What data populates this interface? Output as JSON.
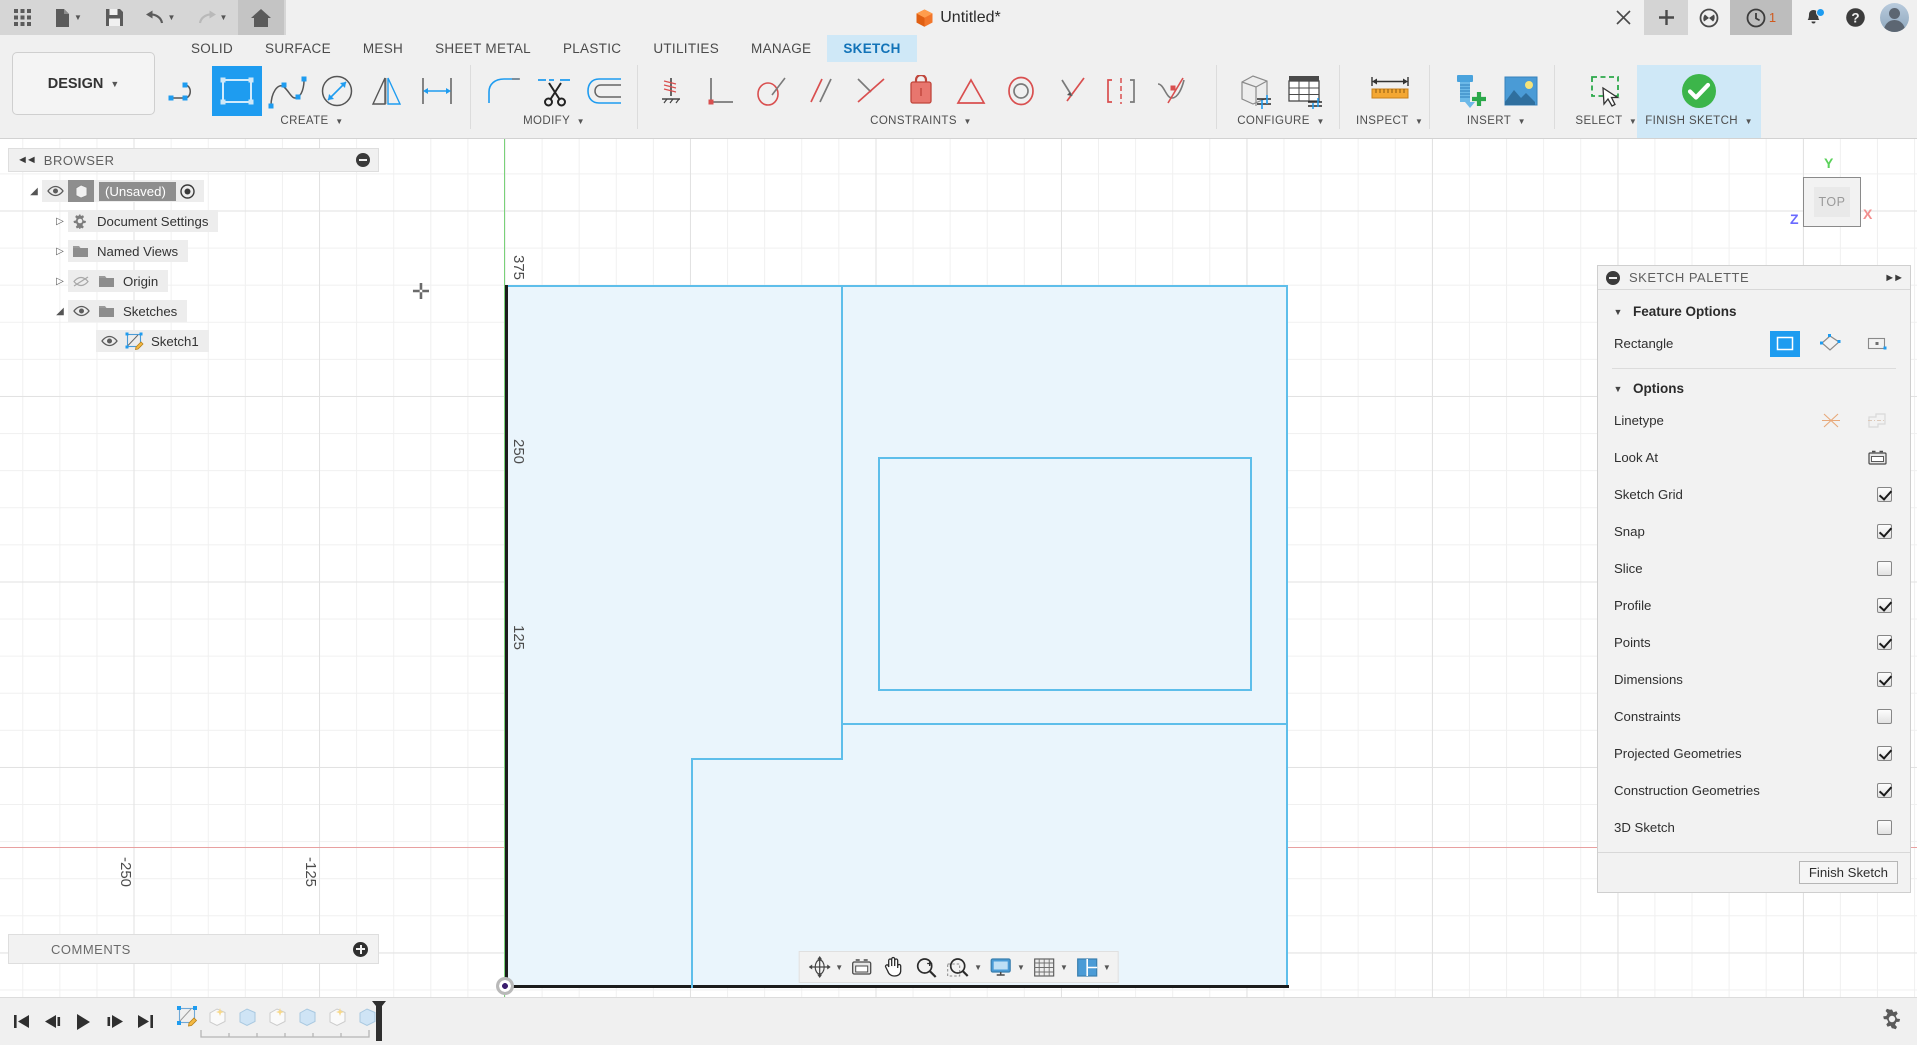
{
  "title_bar": {
    "document_title": "Untitled*",
    "quick_access": [
      {
        "name": "app-grid-icon",
        "label": "Apps"
      },
      {
        "name": "new-file-icon",
        "label": "File"
      },
      {
        "name": "save-icon",
        "label": "Save"
      },
      {
        "name": "undo-icon",
        "label": "Undo"
      },
      {
        "name": "redo-icon",
        "label": "Redo"
      },
      {
        "name": "home-icon",
        "label": "Home"
      }
    ],
    "right_actions": [
      {
        "name": "close-tab-icon",
        "label": "Close"
      },
      {
        "name": "add-tab-icon",
        "label": "New Tab"
      },
      {
        "name": "extensions-icon",
        "label": "Extensions"
      },
      {
        "name": "job-status-icon",
        "label": "Job Status",
        "badge": "1"
      },
      {
        "name": "notifications-icon",
        "label": "Notifications"
      },
      {
        "name": "help-icon",
        "label": "Help"
      },
      {
        "name": "account-avatar",
        "label": "Account"
      }
    ]
  },
  "ribbon": {
    "workspace": "DESIGN",
    "tabs": [
      {
        "label": "SOLID",
        "active": false
      },
      {
        "label": "SURFACE",
        "active": false
      },
      {
        "label": "MESH",
        "active": false
      },
      {
        "label": "SHEET METAL",
        "active": false
      },
      {
        "label": "PLASTIC",
        "active": false
      },
      {
        "label": "UTILITIES",
        "active": false
      },
      {
        "label": "MANAGE",
        "active": false
      },
      {
        "label": "SKETCH",
        "active": true
      }
    ],
    "groups": [
      {
        "name": "create",
        "label": "CREATE",
        "tools": [
          {
            "name": "line-tool",
            "label": "Line",
            "selected": false
          },
          {
            "name": "rectangle-tool",
            "label": "Rectangle",
            "selected": true
          },
          {
            "name": "spline-tool",
            "label": "Spline",
            "selected": false
          },
          {
            "name": "circle-tool",
            "label": "Circle",
            "selected": false
          },
          {
            "name": "mirror-tool",
            "label": "Mirror",
            "selected": false
          },
          {
            "name": "sketch-dimension-tool",
            "label": "Sketch Dimension",
            "selected": false
          }
        ]
      },
      {
        "name": "modify",
        "label": "MODIFY",
        "tools": [
          {
            "name": "fillet-tool",
            "label": "Fillet",
            "selected": false
          },
          {
            "name": "trim-tool",
            "label": "Trim",
            "selected": false
          },
          {
            "name": "offset-tool",
            "label": "Offset",
            "selected": false
          }
        ]
      },
      {
        "name": "constraints",
        "label": "CONSTRAINTS",
        "tools": [
          {
            "name": "fix-unfix-constraint",
            "label": "Fix/UnFix",
            "selected": false
          },
          {
            "name": "perpendicular-constraint",
            "label": "Perpendicular",
            "selected": false
          },
          {
            "name": "tangent-constraint",
            "label": "Tangent",
            "selected": false
          },
          {
            "name": "parallel-constraint",
            "label": "Parallel",
            "selected": false
          },
          {
            "name": "coincident-constraint",
            "label": "Coincident",
            "selected": false
          },
          {
            "name": "horizontal-vertical-constraint",
            "label": "Horizontal/Vertical",
            "selected": false
          },
          {
            "name": "equal-constraint",
            "label": "Equal",
            "selected": false
          },
          {
            "name": "concentric-constraint",
            "label": "Concentric",
            "selected": false
          },
          {
            "name": "collinear-constraint",
            "label": "Collinear",
            "selected": false
          },
          {
            "name": "symmetry-constraint",
            "label": "Symmetry",
            "selected": false
          },
          {
            "name": "curvature-constraint",
            "label": "Curvature",
            "selected": false
          }
        ]
      },
      {
        "name": "configure",
        "label": "CONFIGURE",
        "tools": [
          {
            "name": "configure-component-tool",
            "label": "Configure Component",
            "selected": false
          },
          {
            "name": "configure-table-tool",
            "label": "Configuration Table",
            "selected": false
          }
        ]
      },
      {
        "name": "inspect",
        "label": "INSPECT",
        "tools": [
          {
            "name": "measure-tool",
            "label": "Measure",
            "selected": false
          }
        ]
      },
      {
        "name": "insert",
        "label": "INSERT",
        "tools": [
          {
            "name": "insert-mcmaster-tool",
            "label": "Insert McMaster-Carr Component",
            "selected": false
          },
          {
            "name": "insert-canvas-tool",
            "label": "Canvas",
            "selected": false
          }
        ]
      },
      {
        "name": "select",
        "label": "SELECT",
        "tools": [
          {
            "name": "select-tool",
            "label": "Select",
            "selected": false
          }
        ]
      },
      {
        "name": "finish-sketch",
        "label": "FINISH SKETCH",
        "highlighted": true,
        "tools": [
          {
            "name": "finish-sketch-tool",
            "label": "Finish Sketch",
            "selected": false
          }
        ]
      }
    ]
  },
  "browser": {
    "title": "BROWSER",
    "collapse_icon": "minus-circle-icon",
    "expand_icon": "double-chevron-left-icon",
    "items": [
      {
        "name": "browser-item-unsaved",
        "label": "(Unsaved)",
        "indent": 0,
        "expanded": true,
        "visible": true,
        "selected": true,
        "icon": "component-icon",
        "has_activate_dot": true
      },
      {
        "name": "browser-item-document-settings",
        "label": "Document Settings",
        "indent": 1,
        "expanded": false,
        "visible": null,
        "icon": "gear-icon"
      },
      {
        "name": "browser-item-named-views",
        "label": "Named Views",
        "indent": 1,
        "expanded": false,
        "visible": null,
        "icon": "folder-icon"
      },
      {
        "name": "browser-item-origin",
        "label": "Origin",
        "indent": 1,
        "expanded": false,
        "visible": false,
        "icon": "folder-icon"
      },
      {
        "name": "browser-item-sketches",
        "label": "Sketches",
        "indent": 1,
        "expanded": true,
        "visible": true,
        "icon": "folder-icon"
      },
      {
        "name": "browser-item-sketch1",
        "label": "Sketch1",
        "indent": 2,
        "expanded": null,
        "visible": true,
        "icon": "sketch-icon"
      }
    ]
  },
  "canvas": {
    "view_cube": {
      "face_label": "TOP",
      "axis_y": "Y",
      "axis_x": "X",
      "axis_z": "Z"
    },
    "y_axis_labels": [
      "375",
      "250",
      "125"
    ],
    "x_axis_labels": [
      "-250",
      "-125"
    ],
    "colors": {
      "sketch_line": "#5ebeea",
      "profile_fill": "#eaf5fc",
      "x_axis": "#e8a0a0",
      "y_axis": "#79d279",
      "grid_minor": "#f0f0f0",
      "grid_major": "#e2e2e2"
    }
  },
  "comments": {
    "title": "COMMENTS",
    "add_icon": "plus-circle-icon"
  },
  "nav_bar": {
    "items": [
      {
        "name": "orbit-tool",
        "label": "Orbit",
        "has_caret": true
      },
      {
        "name": "look-at-tool",
        "label": "Look At",
        "has_caret": false
      },
      {
        "name": "pan-tool",
        "label": "Pan",
        "has_caret": false
      },
      {
        "name": "zoom-tool",
        "label": "Zoom",
        "has_caret": false
      },
      {
        "name": "zoom-window-tool",
        "label": "Fit",
        "has_caret": true
      },
      {
        "name": "display-settings-tool",
        "label": "Display Settings",
        "has_caret": true
      },
      {
        "name": "grid-snaps-tool",
        "label": "Grid and Snaps",
        "has_caret": true
      },
      {
        "name": "viewports-tool",
        "label": "Viewports",
        "has_caret": true
      }
    ]
  },
  "timeline": {
    "controls": [
      {
        "name": "timeline-go-start",
        "label": "Go to Beginning"
      },
      {
        "name": "timeline-step-back",
        "label": "Step Back"
      },
      {
        "name": "timeline-play",
        "label": "Play"
      },
      {
        "name": "timeline-step-forward",
        "label": "Step Forward"
      },
      {
        "name": "timeline-go-end",
        "label": "Go to End"
      }
    ],
    "features": [
      {
        "name": "timeline-feature-sketch1",
        "label": "Sketch1",
        "type": "sketch",
        "active": true
      },
      {
        "name": "timeline-feature-2",
        "label": "Feature",
        "type": "new-body",
        "active": false
      },
      {
        "name": "timeline-feature-3",
        "label": "Feature",
        "type": "body",
        "active": false
      },
      {
        "name": "timeline-feature-4",
        "label": "Feature",
        "type": "new-body",
        "active": false
      },
      {
        "name": "timeline-feature-5",
        "label": "Feature",
        "type": "body",
        "active": false
      },
      {
        "name": "timeline-feature-6",
        "label": "Feature",
        "type": "new-body",
        "active": false
      },
      {
        "name": "timeline-feature-7",
        "label": "Feature",
        "type": "body",
        "active": false
      }
    ],
    "settings_icon": "gear-icon"
  },
  "sketch_palette": {
    "title": "SKETCH PALETTE",
    "collapse_icon": "minus-circle-icon",
    "expand_icon": "double-chevron-right-icon",
    "sections": [
      {
        "name": "feature-options",
        "title": "Feature Options",
        "expanded": true,
        "rows": [
          {
            "name": "rectangle-mode-row",
            "label": "Rectangle",
            "control": "icon-group",
            "options": [
              {
                "name": "rectangle-2point-option",
                "label": "2-Point Rectangle",
                "selected": true
              },
              {
                "name": "rectangle-3point-option",
                "label": "3-Point Rectangle",
                "selected": false
              },
              {
                "name": "rectangle-center-option",
                "label": "Center Rectangle",
                "selected": false
              }
            ]
          }
        ]
      },
      {
        "name": "options",
        "title": "Options",
        "expanded": true,
        "rows": [
          {
            "name": "linetype-row",
            "label": "Linetype",
            "control": "icon-group",
            "options": [
              {
                "name": "linetype-normal-option",
                "label": "Normal",
                "selected": false
              },
              {
                "name": "linetype-construction-option",
                "label": "Construction",
                "selected": false
              }
            ]
          },
          {
            "name": "look-at-row",
            "label": "Look At",
            "control": "icon-button"
          },
          {
            "name": "sketch-grid-row",
            "label": "Sketch Grid",
            "control": "checkbox",
            "checked": true
          },
          {
            "name": "snap-row",
            "label": "Snap",
            "control": "checkbox",
            "checked": true
          },
          {
            "name": "slice-row",
            "label": "Slice",
            "control": "checkbox",
            "checked": false
          },
          {
            "name": "profile-row",
            "label": "Profile",
            "control": "checkbox",
            "checked": true
          },
          {
            "name": "points-row",
            "label": "Points",
            "control": "checkbox",
            "checked": true
          },
          {
            "name": "dimensions-row",
            "label": "Dimensions",
            "control": "checkbox",
            "checked": true
          },
          {
            "name": "constraints-row",
            "label": "Constraints",
            "control": "checkbox",
            "checked": false
          },
          {
            "name": "projected-geometries-row",
            "label": "Projected Geometries",
            "control": "checkbox",
            "checked": true
          },
          {
            "name": "construction-geometries-row",
            "label": "Construction Geometries",
            "control": "checkbox",
            "checked": true
          },
          {
            "name": "3d-sketch-row",
            "label": "3D Sketch",
            "control": "checkbox",
            "checked": false
          }
        ]
      }
    ],
    "footer_button": "Finish Sketch"
  }
}
